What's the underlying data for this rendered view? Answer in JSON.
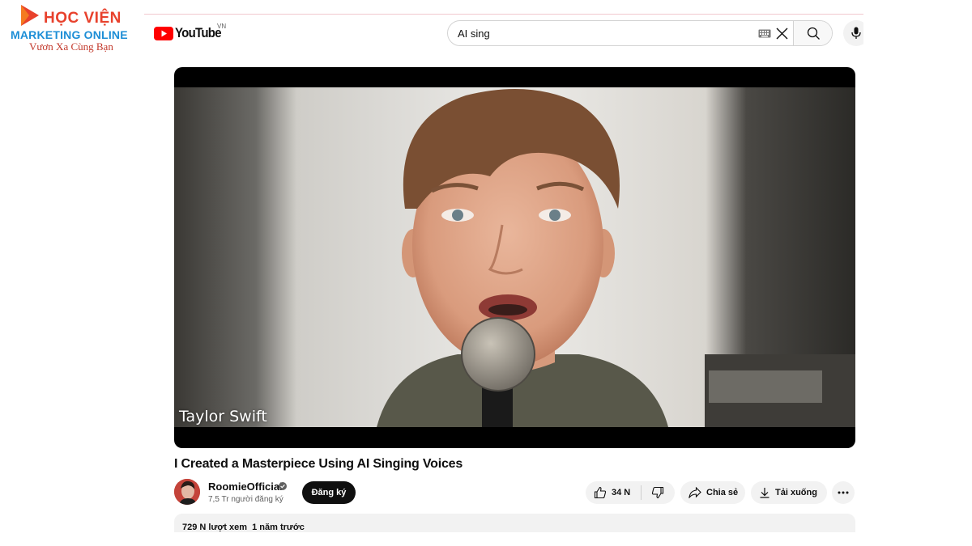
{
  "brand": {
    "line1": "HỌC VIỆN",
    "line2": "MARKETING ONLINE",
    "line3": "Vươn Xa Cùng Bạn",
    "icon": "play-logo-icon"
  },
  "header": {
    "logo_text": "YouTube",
    "region": "VN",
    "search_query": "AI sing",
    "icons": [
      "keyboard-icon",
      "clear-icon",
      "search-icon",
      "mic-icon"
    ]
  },
  "player": {
    "caption": "Taylor Swift"
  },
  "video": {
    "title": "I Created a Masterpiece Using AI Singing Voices",
    "channel": "RoomieOfficial",
    "subscribers": "7,5 Tr người đăng ký",
    "subscribe_label": "Đăng ký",
    "likes": "34 N",
    "share_label": "Chia sẻ",
    "download_label": "Tải xuống",
    "views": "729 N lượt xem",
    "published": "1 năm trước"
  },
  "colors": {
    "brand_red": "#e8412c",
    "brand_blue": "#1d8ed6",
    "youtube_red": "#ff0000",
    "subscribe_bg": "#0f0f0f",
    "pill_bg": "#f2f2f2"
  }
}
